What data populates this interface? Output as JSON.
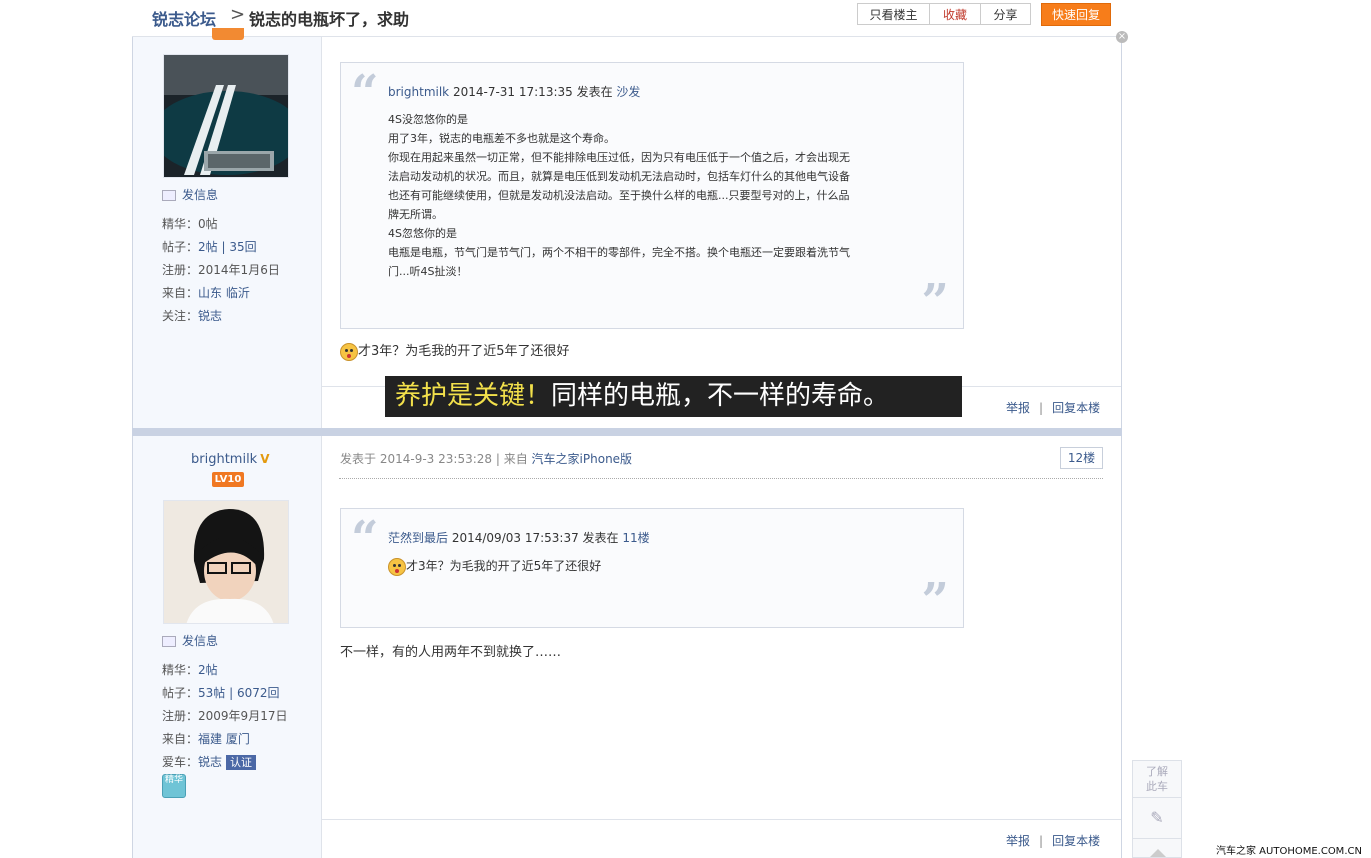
{
  "header": {
    "forum": "锐志论坛",
    "separator": ">",
    "title": "锐志的电瓶坏了，求助",
    "buttons": {
      "only_op": "只看楼主",
      "favorite": "收藏",
      "share": "分享",
      "quick_reply": "快速回复"
    }
  },
  "user1": {
    "message": "发信息",
    "stats": [
      {
        "label": "精华：",
        "value": "0帖"
      },
      {
        "label": "帖子：",
        "value": "2帖 | 35回"
      },
      {
        "label": "注册：",
        "value": "2014年1月6日"
      },
      {
        "label": "来自：",
        "value": "山东 临沂"
      },
      {
        "label": "关注：",
        "value": "锐志"
      }
    ]
  },
  "post1": {
    "quote_author": "brightmilk",
    "quote_time": "2014-7-31 17:13:35 发表在",
    "quote_floor": "沙发",
    "quote_lines": [
      "4S没忽悠你的是",
      "用了3年，锐志的电瓶差不多也就是这个寿命。",
      "你现在用起来虽然一切正常，但不能排除电压过低，因为只有电压低于一个值之后，才会出现无",
      "法启动发动机的状况。而且，就算是电压低到发动机无法启动时，包括车灯什么的其他电气设备",
      "也还有可能继续使用，但就是发动机没法启动。至于换什么样的电瓶...只要型号对的上，什么品",
      "牌无所谓。",
      "4S忽悠你的是",
      "电瓶是电瓶，节气门是节气门，两个不相干的零部件，完全不搭。换个电瓶还一定要跟着洗节气",
      "门...听4S扯淡！"
    ],
    "text": "才3年？为毛我的开了近5年了还很好",
    "report": "举报",
    "reply": "回复本楼"
  },
  "subtitle": {
    "highlight": "养护是关键！",
    "rest": "同样的电瓶，不一样的寿命。"
  },
  "user2": {
    "name": "brightmilk",
    "vip": "V",
    "level": "LV10",
    "message": "发信息",
    "stats": [
      {
        "label": "精华：",
        "value": "2帖"
      },
      {
        "label": "帖子：",
        "value": "53帖 | 6072回"
      },
      {
        "label": "注册：",
        "value": "2009年9月17日"
      },
      {
        "label": "来自：",
        "value": "福建 厦门"
      },
      {
        "label": "爱车：",
        "value": "锐志"
      }
    ],
    "cert": "认证",
    "medal": "精华"
  },
  "post2": {
    "posted_label": "发表于",
    "posted_time": "2014-9-3 23:53:28",
    "from_label": "| 来自",
    "from_client": "汽车之家iPhone版",
    "floor": "12楼",
    "quote_author": "茫然到最后",
    "quote_time": "2014/09/03 17:53:37 发表在",
    "quote_floor": "11楼",
    "quote_text": "才3年？为毛我的开了近5年了还很好",
    "text": "不一样，有的人用两年不到就换了……",
    "report": "举报",
    "reply": "回复本楼"
  },
  "side": {
    "learn_line1": "了解",
    "learn_line2": "此车"
  },
  "watermark": "汽车之家 AUTOHOME.COM.CN",
  "colors": {
    "accent": "#f77d1a",
    "link": "#3b5a8c",
    "separator": "#c9d2e3"
  }
}
